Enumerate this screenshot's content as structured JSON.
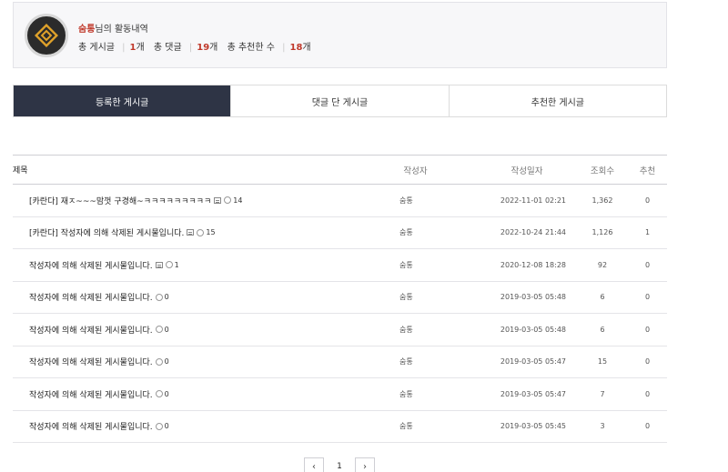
{
  "profile": {
    "nickname": "숨통",
    "title_suffix": "님의 활동내역",
    "posts_label": "총 게시글",
    "posts_count": "1",
    "comments_label": "총 댓글",
    "comments_count": "19",
    "recommends_label": "총 추천한 수",
    "recommends_count": "18",
    "unit": "개"
  },
  "tabs": [
    {
      "label": "등록한 게시글",
      "active": true
    },
    {
      "label": "댓글 단 게시글",
      "active": false
    },
    {
      "label": "추천한 게시글",
      "active": false
    }
  ],
  "table": {
    "headers": {
      "title": "제목",
      "author": "작성자",
      "date": "작성일자",
      "views": "조회수",
      "rec": "추천"
    },
    "rows": [
      {
        "title": "[카란다] 재ㅈ~~~맘껏 구경해~ㅋㅋㅋㅋㅋㅋㅋㅋㅋ",
        "has_image": true,
        "comments": "14",
        "author": "숨통",
        "date": "2022-11-01 02:21",
        "views": "1,362",
        "rec": "0"
      },
      {
        "title": "[카란다] 작성자에 의해 삭제된 게시물입니다.",
        "has_image": true,
        "comments": "15",
        "author": "숨통",
        "date": "2022-10-24 21:44",
        "views": "1,126",
        "rec": "1"
      },
      {
        "title": "작성자에 의해 삭제된 게시물입니다.",
        "has_image": true,
        "comments": "1",
        "author": "숨통",
        "date": "2020-12-08 18:28",
        "views": "92",
        "rec": "0"
      },
      {
        "title": "작성자에 의해 삭제된 게시물입니다.",
        "has_image": false,
        "comments": "0",
        "author": "숨통",
        "date": "2019-03-05 05:48",
        "views": "6",
        "rec": "0"
      },
      {
        "title": "작성자에 의해 삭제된 게시물입니다.",
        "has_image": false,
        "comments": "0",
        "author": "숨통",
        "date": "2019-03-05 05:48",
        "views": "6",
        "rec": "0"
      },
      {
        "title": "작성자에 의해 삭제된 게시물입니다.",
        "has_image": false,
        "comments": "0",
        "author": "숨통",
        "date": "2019-03-05 05:47",
        "views": "15",
        "rec": "0"
      },
      {
        "title": "작성자에 의해 삭제된 게시물입니다.",
        "has_image": false,
        "comments": "0",
        "author": "숨통",
        "date": "2019-03-05 05:47",
        "views": "7",
        "rec": "0"
      },
      {
        "title": "작성자에 의해 삭제된 게시물입니다.",
        "has_image": false,
        "comments": "0",
        "author": "숨통",
        "date": "2019-03-05 05:45",
        "views": "3",
        "rec": "0"
      }
    ]
  },
  "pager": {
    "prev": "‹",
    "current": "1",
    "next": "›"
  },
  "colors": {
    "accent": "#c0392b",
    "tab_active_bg": "#2e3445"
  }
}
